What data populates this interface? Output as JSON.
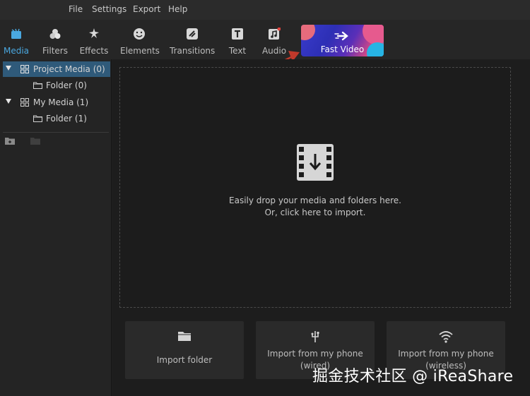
{
  "menu": {
    "items": [
      "File",
      "Settings",
      "Export",
      "Help"
    ]
  },
  "toolbar": {
    "tabs": [
      {
        "label": "Media",
        "icon": "media-icon",
        "active": true
      },
      {
        "label": "Filters",
        "icon": "filters-icon",
        "active": false
      },
      {
        "label": "Effects",
        "icon": "effects-icon",
        "active": false
      },
      {
        "label": "Elements",
        "icon": "elements-icon",
        "active": false
      },
      {
        "label": "Transitions",
        "icon": "transitions-icon",
        "active": false
      },
      {
        "label": "Text",
        "icon": "text-icon",
        "active": false
      },
      {
        "label": "Audio",
        "icon": "audio-icon",
        "active": false
      }
    ],
    "fast_video": {
      "label": "Fast Video",
      "icon": "fast-forward-icon"
    }
  },
  "sidebar": {
    "tree": [
      {
        "label": "Project Media (0)",
        "type": "group",
        "selected": true
      },
      {
        "label": "Folder (0)",
        "type": "folder",
        "selected": false
      },
      {
        "label": "My Media (1)",
        "type": "group",
        "selected": false
      },
      {
        "label": "Folder (1)",
        "type": "folder",
        "selected": false
      }
    ]
  },
  "dropzone": {
    "line1": "Easily drop your media and folders here.",
    "line2": "Or, click here to import.",
    "icon": "film-download-icon"
  },
  "import_buttons": [
    {
      "label": "Import folder",
      "icon": "folder-icon"
    },
    {
      "label": "Import from my phone (wired)",
      "line1": "Import from my phone",
      "line2": "(wired)",
      "icon": "usb-icon"
    },
    {
      "label": "Import from my phone (wireless)",
      "line1": "Import from my phone",
      "line2": "(wireless)",
      "icon": "wifi-icon"
    }
  ],
  "watermark": "掘金技术社区 @ iReaShare",
  "colors": {
    "accent": "#4aa8e0",
    "selection": "#2f5a7a",
    "annotation_arrow": "#c0392b"
  }
}
